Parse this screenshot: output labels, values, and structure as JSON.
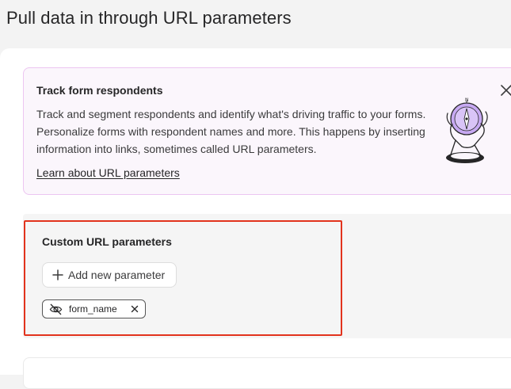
{
  "page": {
    "title": "Pull data in through URL parameters"
  },
  "info_card": {
    "title": "Track form respondents",
    "text": "Track and segment respondents and identify what's driving traffic to your forms. Personalize forms with respondent names and more. This happens by inserting information into links, sometimes called URL parameters.",
    "link_label": "Learn about URL parameters",
    "close_icon": "close-icon",
    "illustration_icon": "hand-compass-illustration"
  },
  "custom_params": {
    "title": "Custom URL parameters",
    "add_button_label": "Add new parameter",
    "add_icon": "plus-icon",
    "params": [
      {
        "name": "form_name",
        "visibility_icon": "eye-off-icon",
        "remove_icon": "close-icon"
      }
    ]
  },
  "colors": {
    "info_card_bg": "#fbf6fc",
    "info_card_border": "#ecc5f1",
    "highlight_border": "#e2331d",
    "settings_bg": "#f5f5f5"
  }
}
